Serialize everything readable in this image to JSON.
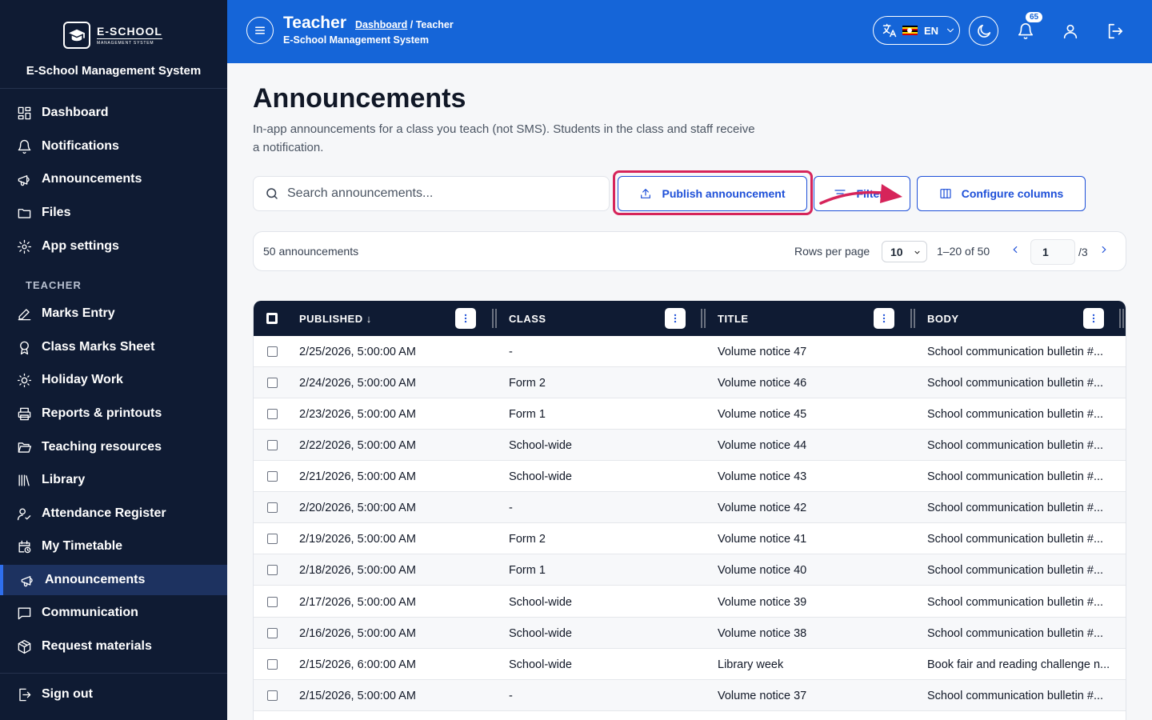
{
  "sidebar": {
    "logo_big": "E-SCHOOL",
    "logo_small": "MANAGEMENT SYSTEM",
    "system_name": "E-School Management System",
    "general_items": [
      {
        "label": "Dashboard",
        "icon": "dashboard-icon"
      },
      {
        "label": "Notifications",
        "icon": "bell-icon"
      },
      {
        "label": "Announcements",
        "icon": "megaphone-icon"
      },
      {
        "label": "Files",
        "icon": "folder-icon"
      },
      {
        "label": "App settings",
        "icon": "gear-icon"
      }
    ],
    "section_label": "TEACHER",
    "teacher_items": [
      {
        "label": "Marks Entry",
        "icon": "pencil-icon"
      },
      {
        "label": "Class Marks Sheet",
        "icon": "award-icon"
      },
      {
        "label": "Holiday Work",
        "icon": "sun-icon"
      },
      {
        "label": "Reports & printouts",
        "icon": "printer-icon"
      },
      {
        "label": "Teaching resources",
        "icon": "folder-open-icon"
      },
      {
        "label": "Library",
        "icon": "library-icon"
      },
      {
        "label": "Attendance Register",
        "icon": "user-check-icon"
      },
      {
        "label": "My Timetable",
        "icon": "calendar-clock-icon"
      },
      {
        "label": "Announcements",
        "icon": "megaphone-icon"
      },
      {
        "label": "Communication",
        "icon": "chat-icon"
      },
      {
        "label": "Request materials",
        "icon": "package-icon"
      }
    ],
    "sign_out": "Sign out"
  },
  "header": {
    "title": "Teacher",
    "breadcrumb_link": "Dashboard",
    "breadcrumb_rest": " / Teacher",
    "subtitle": "E-School Management System",
    "language": "EN",
    "notification_count": "65",
    "accent_color": "#1565d8"
  },
  "main": {
    "title": "Announcements",
    "description": "In-app announcements for a class you teach (not SMS). Students in the class and staff receive a notification.",
    "search_placeholder": "Search announcements...",
    "publish_button": "Publish announcement",
    "filter_button": "Filters",
    "configure_button": "Configure columns",
    "annotation_color": "#d6245a"
  },
  "pager": {
    "count_label": "50 announcements",
    "rows_per_page_label": "Rows per page",
    "rows_per_page_value": "10",
    "range_label": "1–20 of 50",
    "current_page": "1",
    "total_pages": "/3"
  },
  "table": {
    "columns": [
      "PUBLISHED ↓",
      "CLASS",
      "TITLE",
      "BODY"
    ],
    "rows": [
      {
        "published": "2/25/2026, 5:00:00 AM",
        "class": "-",
        "title": "Volume notice 47",
        "body": "School communication bulletin #..."
      },
      {
        "published": "2/24/2026, 5:00:00 AM",
        "class": "Form 2",
        "title": "Volume notice 46",
        "body": "School communication bulletin #..."
      },
      {
        "published": "2/23/2026, 5:00:00 AM",
        "class": "Form 1",
        "title": "Volume notice 45",
        "body": "School communication bulletin #..."
      },
      {
        "published": "2/22/2026, 5:00:00 AM",
        "class": "School-wide",
        "title": "Volume notice 44",
        "body": "School communication bulletin #..."
      },
      {
        "published": "2/21/2026, 5:00:00 AM",
        "class": "School-wide",
        "title": "Volume notice 43",
        "body": "School communication bulletin #..."
      },
      {
        "published": "2/20/2026, 5:00:00 AM",
        "class": "-",
        "title": "Volume notice 42",
        "body": "School communication bulletin #..."
      },
      {
        "published": "2/19/2026, 5:00:00 AM",
        "class": "Form 2",
        "title": "Volume notice 41",
        "body": "School communication bulletin #..."
      },
      {
        "published": "2/18/2026, 5:00:00 AM",
        "class": "Form 1",
        "title": "Volume notice 40",
        "body": "School communication bulletin #..."
      },
      {
        "published": "2/17/2026, 5:00:00 AM",
        "class": "School-wide",
        "title": "Volume notice 39",
        "body": "School communication bulletin #..."
      },
      {
        "published": "2/16/2026, 5:00:00 AM",
        "class": "School-wide",
        "title": "Volume notice 38",
        "body": "School communication bulletin #..."
      },
      {
        "published": "2/15/2026, 6:00:00 AM",
        "class": "School-wide",
        "title": "Library week",
        "body": "Book fair and reading challenge n..."
      },
      {
        "published": "2/15/2026, 5:00:00 AM",
        "class": "-",
        "title": "Volume notice 37",
        "body": "School communication bulletin #..."
      }
    ]
  }
}
